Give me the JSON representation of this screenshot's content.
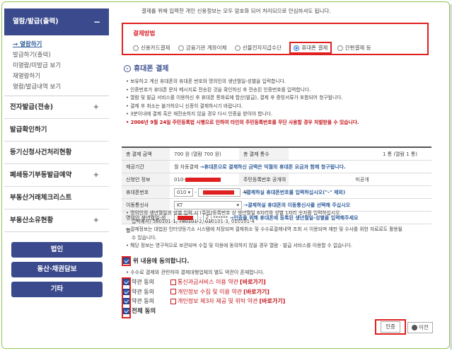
{
  "sidebar": {
    "header": "열람/발급(출력)",
    "header_toggle": "−",
    "sub_items": [
      {
        "label": "→ 열람하기",
        "active": true
      },
      {
        "label": "발급하기(출력)",
        "active": false
      },
      {
        "label": "미열람/미발급 보기",
        "active": false
      },
      {
        "label": "재열람하기",
        "active": false
      },
      {
        "label": "열람/발급내역 보기",
        "active": false
      }
    ],
    "menu": [
      {
        "label": "전자발급(전송)",
        "toggle": "+"
      },
      {
        "label": "발급확인하기",
        "toggle": ""
      },
      {
        "label": "등기신청사건처리현황",
        "toggle": ""
      },
      {
        "label": "폐쇄등기부등발급예약",
        "toggle": "+"
      },
      {
        "label": "부동산거래체크리스트",
        "toggle": ""
      },
      {
        "label": "부동산소유현황",
        "toggle": "+"
      }
    ],
    "buttons": [
      "법인",
      "동산·채권담보",
      "기타"
    ]
  },
  "main": {
    "notice": "결제를 위해 입력한 개인 신용정보는 모두 암호화 되어 처리되므로 안심하셔도 됩니다.",
    "payment": {
      "title": "결제방법",
      "options": [
        "신용카드결제",
        "금융기관 계좌이체",
        "선불전자지급수단",
        "휴대폰 결제",
        "간편결제 등"
      ],
      "selected_index": 3
    },
    "section_title": "휴대폰 결제",
    "bullets": [
      "보유하고 계신 휴대폰의 휴대폰 번호와 명의인의 생년월일-성별을 입력합니다.",
      "인증번호가 휴대폰 문자 메시지로 전송된 것을 확인하신 후 전송된 인증번호를 입력합니다.",
      "열람 및 발급 서비스를 이용하신 후 휴대폰 통화료에 합산(발급), 결제 후 증빙서류가 포함되어 청구됩니다.",
      "결제 후 취소는 불가하오니 신중히 결제하시기 바랍니다.",
      "3분이내에 결제 혹은 재전송하지 않을 경우 다시 인증을 받아야 합니다."
    ],
    "bullet_red": "2006년 9월 24일 주민등록법 시행으로 인하여 타인의 주민등록번호를 무단 사용할 경우 처벌받을 수 있습니다.",
    "table": {
      "total_label": "총 결제 금액",
      "total_value": "700 원 (열람 700 원)",
      "count_label": "총 결제 통수",
      "count_value": "1 통 (열람 1 통)",
      "provider_label": "제공기간",
      "provider_value": "월 자동결제",
      "provider_note": "→휴대폰으로 결제하신 금액은 익월의 휴대폰 요금과 함께 청구됩니다.",
      "applicant_label": "신청인 정보",
      "applicant_value": "010-",
      "rrn_label": "주민등록번호 공개여부",
      "rrn_value": "미공개",
      "phone_label": "휴대폰번호",
      "phone_prefix": "010",
      "phone_note": "→결제하실 휴대폰번호를 입력하십시오(\"-\" 제외)",
      "carrier_label": "이동통신사",
      "carrier_value": "KT",
      "carrier_note": "→결제하실 휴대폰의 이동통신사를 선택해 주십시오",
      "birth_label": "명의인 생년월일-성별",
      "birth_gender": "2",
      "birth_mask": "******",
      "birth_note": "→인증을 위해 휴대폰에 등록된 생년월일-성별을 입력해주세요"
    },
    "notes": [
      "명의인의 생년월일과 성별 입력 시 (주민)등록번호 상 생년월일 6자리와 성별 1자리 숫자를 입력하십시오.",
      "입력예시) 560101-1, 780101-2, 010101-3, 010101-4",
      "결제정보는 대법원 인터넷등기소 시스템에 저장되며 결제취소 및 수수료결제내역 조회 시 이용되며 재판 및 수사를 위한 자료로도 활용될",
      "수 있습니다.",
      "해당 정보는 영구적으로 보관되며 수집 및 이용에 동의하지 않을 경우 열람 · 발급 서비스를 이용할 수 없습니다."
    ],
    "agree_one": "위 내용에 동의합니다.",
    "agree_note": "수수료 결제와 관련하여 결제대행업체의 별도 약관이 존재합니다.",
    "agree_items": [
      {
        "label": "약관 동의",
        "doc": "통신과금서비스 이용 약관",
        "view": "[바로가기]"
      },
      {
        "label": "약관 동의",
        "doc": "개인정보 수집 및 이용 약관",
        "view": "[바로가기]"
      },
      {
        "label": "약관 동의",
        "doc": "개인정보 제3자 제공 및 위탁 약관",
        "view": "[바로가기]"
      }
    ],
    "agree_all": "전체 동의",
    "btn_ok": "인증",
    "btn_prev": "이전"
  }
}
